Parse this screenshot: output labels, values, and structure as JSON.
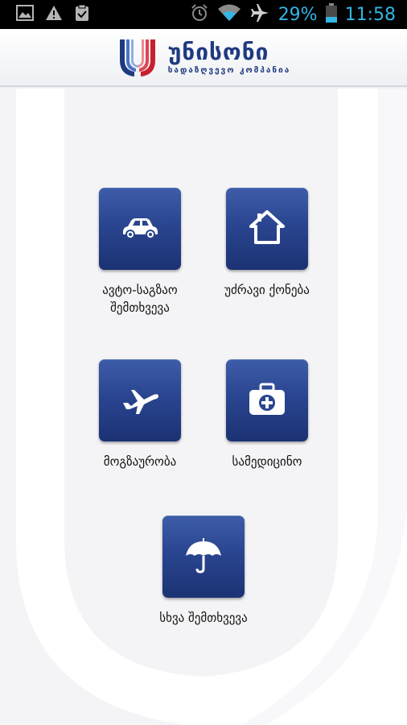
{
  "status_bar": {
    "battery": "29%",
    "time": "11:58",
    "left_icons": [
      "image-icon",
      "warning-icon",
      "clipboard-icon"
    ],
    "right_icons": [
      "alarm-icon",
      "wifi-icon",
      "airplane-mode-icon",
      "battery-icon"
    ],
    "accent_color": "#33b5e5"
  },
  "header": {
    "logo_title": "უნისონი",
    "logo_subtitle": "სადაზღვევო კომპანია",
    "brand_color": "#1f3a80",
    "logo_stripe_colors": [
      "#1f3a80",
      "#c8202f"
    ]
  },
  "tiles": [
    {
      "icon": "car-icon",
      "label_lines": [
        "ავტო-საგზაო",
        "შემთხვევა"
      ]
    },
    {
      "icon": "house-icon",
      "label_lines": [
        "უძრავი ქონება"
      ]
    },
    {
      "icon": "airplane-icon",
      "label_lines": [
        "მოგზაურობა"
      ]
    },
    {
      "icon": "medical-kit-icon",
      "label_lines": [
        "სამედიცინო"
      ]
    },
    {
      "icon": "umbrella-icon",
      "label_lines": [
        "სხვა შემთხვევა"
      ]
    }
  ],
  "tile_color": "#2a4590"
}
